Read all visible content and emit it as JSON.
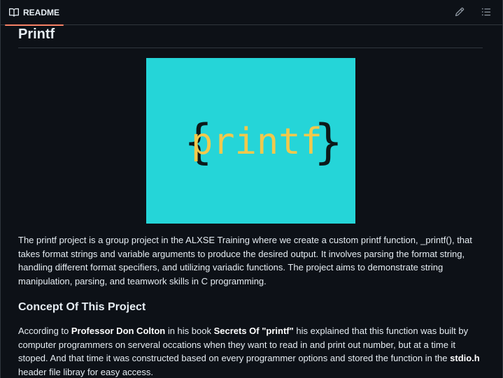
{
  "tab": {
    "label": "README",
    "icon": "book-icon"
  },
  "actions": {
    "edit_icon": "pencil-icon",
    "outline_icon": "list-icon"
  },
  "title": "Printf",
  "banner": {
    "open_brace": "{",
    "word": "printf",
    "close_brace": "}",
    "background": "#25d5d8",
    "word_color": "#f2c94c",
    "brace_color": "#0d1a1a"
  },
  "intro": "The printf project is a group project in the ALXSE Training where we create a custom printf function, _printf(), that takes format strings and variable arguments to produce the desired output. It involves parsing the format string, handling different format specifiers, and utilizing variadic functions. The project aims to demonstrate string manipulation, parsing, and teamwork skills in C programming.",
  "concept": {
    "heading": "Concept Of This Project",
    "t1": "According to ",
    "b1": "Professor Don Colton",
    "t2": " in his book ",
    "b2": "Secrets Of \"printf\"",
    "t3": " his explained that this function was built by computer programmers on serveral occations when they want to read in and print out number, but at a time it stoped. And that time it was constructed based on every programmer options and stored the function in the ",
    "b3": "stdio.h",
    "t4": " header file libray for easy access."
  }
}
